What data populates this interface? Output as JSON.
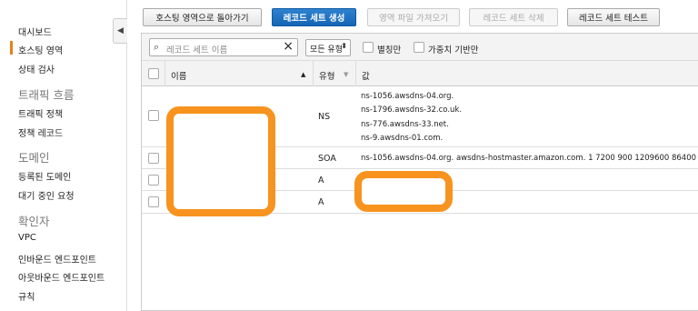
{
  "sidebar": {
    "items_top": [
      "대시보드",
      "호스팅 영역",
      "상태 검사"
    ],
    "section_traffic": "트래픽 흐름",
    "traffic_items": [
      "트래픽 정책",
      "정책 레코드"
    ],
    "section_domain": "도메인",
    "domain_items": [
      "등록된 도메인",
      "대기 중인 요청"
    ],
    "section_resolver": "확인자",
    "resolver_items": [
      "VPC",
      "인바운드 엔드포인트",
      "아웃바운드 엔드포인트",
      "규칙"
    ],
    "collapse_glyph": "◀"
  },
  "toolbar": {
    "back": "호스팅 영역으로 돌아가기",
    "create": "레코드 세트 생성",
    "import": "영역 파일 가져오기",
    "delete": "레코드 세트 삭제",
    "test": "레코드 세트 테스트"
  },
  "filter": {
    "search_placeholder": "레코드 세트 이름",
    "type_select": "모든 유형",
    "alias_label": "별칭만",
    "weighted_label": "가중치 기반만"
  },
  "table": {
    "headers": {
      "name": "이름",
      "type": "유형",
      "value": "값"
    },
    "rows": [
      {
        "type": "NS",
        "values": [
          "ns-1056.awsdns-04.org.",
          "ns-1796.awsdns-32.co.uk.",
          "ns-776.awsdns-33.net.",
          "ns-9.awsdns-01.com."
        ]
      },
      {
        "type": "SOA",
        "values": [
          "ns-1056.awsdns-04.org. awsdns-hostmaster.amazon.com. 1 7200 900 1209600 86400"
        ]
      },
      {
        "type": "A",
        "values": [
          ""
        ]
      },
      {
        "type": "A",
        "values": [
          ""
        ]
      }
    ]
  },
  "colors": {
    "accent": "#e8801a",
    "primary": "#1a6fc2",
    "redaction": "#f7931e"
  }
}
